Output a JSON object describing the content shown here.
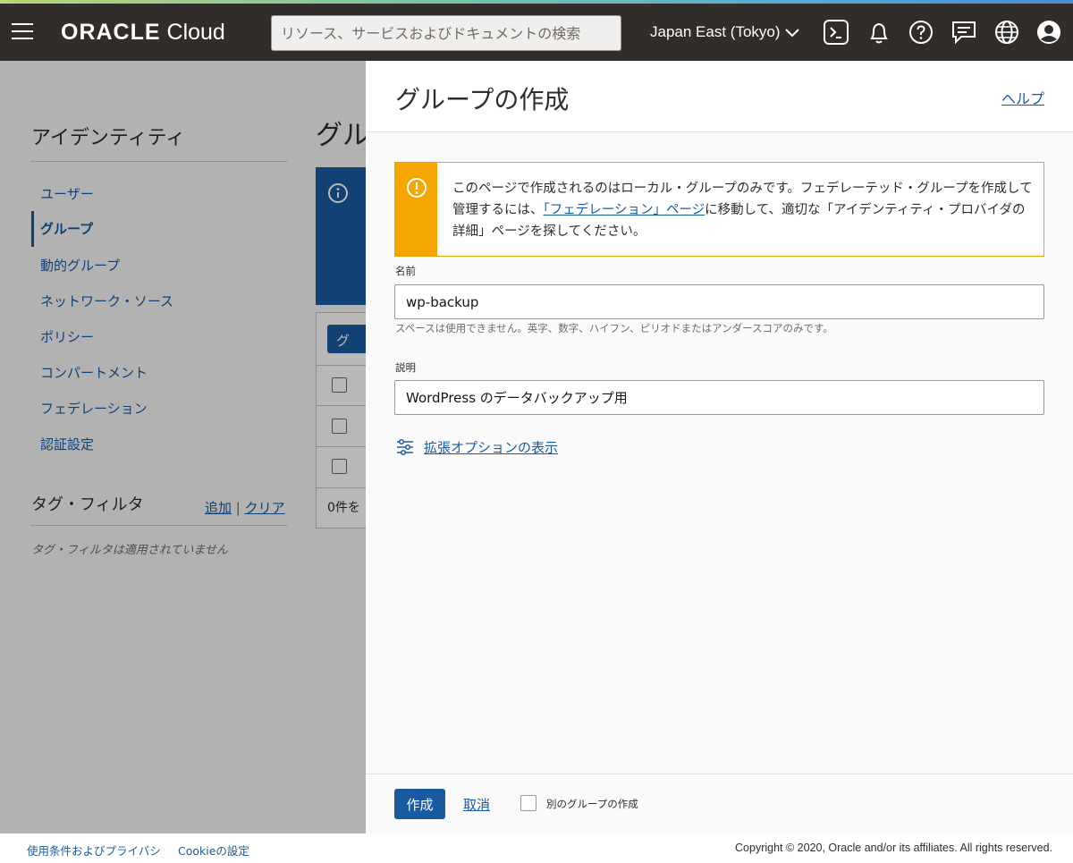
{
  "header": {
    "brand_bold": "ORACLE",
    "brand_light": "Cloud",
    "search_placeholder": "リソース、サービスおよびドキュメントの検索",
    "region": "Japan East (Tokyo)",
    "icons": [
      "cloud-shell-icon",
      "bell-icon",
      "help-icon",
      "chat-icon",
      "globe-icon",
      "user-icon"
    ]
  },
  "sidebar": {
    "title": "アイデンティティ",
    "items": [
      {
        "label": "ユーザー",
        "active": false
      },
      {
        "label": "グループ",
        "active": true
      },
      {
        "label": "動的グループ",
        "active": false
      },
      {
        "label": "ネットワーク・ソース",
        "active": false
      },
      {
        "label": "ポリシー",
        "active": false
      },
      {
        "label": "コンパートメント",
        "active": false
      },
      {
        "label": "フェデレーション",
        "active": false
      },
      {
        "label": "認証設定",
        "active": false
      }
    ],
    "tag_filter": {
      "title": "タグ・フィルタ",
      "add": "追加",
      "sep": "|",
      "clear": "クリア",
      "empty": "タグ・フィルタは適用されていません"
    }
  },
  "background": {
    "heading": "グル",
    "button": "グル",
    "footer_text": "0件を"
  },
  "panel": {
    "title": "グループの作成",
    "help": "ヘルプ",
    "warning": {
      "before": "このページで作成されるのはローカル・グループのみです。フェデレーテッド・グループを作成して管理するには、",
      "link": "「フェデレーション」ページ",
      "after": "に移動して、適切な「アイデンティティ・プロバイダの詳細」ページを探してください。"
    },
    "name_label": "名前",
    "name_value": "wp-backup",
    "name_hint": "スペースは使用できません。英字、数字、ハイフン、ピリオドまたはアンダースコアのみです。",
    "desc_label": "説明",
    "desc_value": "WordPress のデータバックアップ用",
    "advanced": "拡張オプションの表示",
    "create_button": "作成",
    "cancel": "取消",
    "create_another": "別のグループの作成"
  },
  "footer": {
    "terms": "使用条件およびプライバシ",
    "cookie": "Cookieの設定",
    "copyright": "Copyright © 2020, Oracle and/or its affiliates. All rights reserved."
  },
  "colors": {
    "topbar": "#312d2a",
    "link": "#1a5aa0",
    "warning": "#f5a700"
  }
}
